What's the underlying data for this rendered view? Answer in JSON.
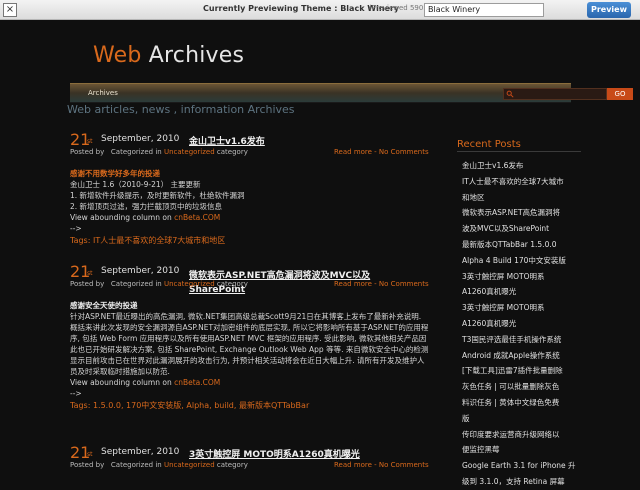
{
  "preview_bar": {
    "close_label": "×",
    "title": "Currently Previewing Theme : Black Winery",
    "subtitle": "(Previewed 590 tim",
    "theme_select": "Black Winery",
    "preview_button": "Preview"
  },
  "header": {
    "title_part1": "Web",
    "title_part2": " Archives",
    "tagline": "Web articles, news , information Archives",
    "nav_item": "Archives",
    "search_placeholder": "",
    "go_button": "GO"
  },
  "posts": [
    {
      "day": "21",
      "suffix": "st",
      "date": "September, 2010",
      "title": "金山卫士v1.6发布",
      "meta_posted": "Posted by",
      "meta_cat_prefix": "Categorized in",
      "meta_cat": "Uncategorized",
      "meta_cat_suffix": "category",
      "more": "Read more - No Comments",
      "lines": [
        "感谢不用数学好多年的投递",
        "金山卫士 1.6（2010-9-21） 主要更新",
        "1. 新增软件升级提示，及时更新软件，杜绝软件漏洞",
        "2. 新增顶页过滤，强力拦截顶页中的垃圾信息",
        "View abounding column on ",
        "cnBeta.COM",
        "-->"
      ],
      "tags_label": "Tags:",
      "tags": "IT人士最不喜欢的全球7大城市和地区"
    },
    {
      "day": "21",
      "suffix": "st",
      "date": "September, 2010",
      "title": "微软表示ASP.NET高危漏洞将波及MVC以及SharePoint",
      "meta_posted": "Posted by",
      "meta_cat_prefix": "Categorized in",
      "meta_cat": "Uncategorized",
      "meta_cat_suffix": "category",
      "more": "Read more - No Comments",
      "lines": [
        "感谢安全天使的投递",
        "针对ASP.NET最近曝出的高危漏洞, 微软.NET集团高级总裁Scott9月21日在其博客上发布了最新补充说明. 概括来讲此次发现的安全漏洞源自ASP.NET对加密组件的底层实现, 所以它将影响所有基于ASP.NET的应用程序, 包括 Web Form 应用程序以及所有使用ASP.NET MVC 框架的应用程序. 受此影响, 微软其他相关产品因此也已开始研发解决方案, 包括 SharePoint, Exchange Outlook Web App 等等. 来自微软安全中心的检测显示目前攻击已在世界对此漏洞展开的攻击行为, 并预计相关活动将会在近日大幅上升. 请所有开发及维护人员及时采取临时措施加以防范.",
        "View abounding column on ",
        "cnBeta.COM",
        "-->"
      ],
      "tags_label": "Tags:",
      "tags": "1.5.0.0, 170中文安装版, Alpha, build, 最新版本QTTabBar"
    },
    {
      "day": "21",
      "suffix": "st",
      "date": "September, 2010",
      "title": "3英寸触控屏 MOTO明系A1260真机曝光",
      "meta_posted": "Posted by",
      "meta_cat_prefix": "Categorized in",
      "meta_cat": "Uncategorized",
      "meta_cat_suffix": "category",
      "more": "Read more - No Comments"
    }
  ],
  "sidebar": {
    "title": "Recent Posts",
    "items": [
      "金山卫士v1.6发布",
      "IT人士最不喜欢的全球7大城市",
      "和地区",
      "微软表示ASP.NET高危漏洞将",
      "波及MVC以及SharePoint",
      "最新版本QTTabBar 1.5.0.0",
      "Alpha 4 Build 170中文安装版",
      "3英寸触控屏 MOTO明系",
      "A1260真机曝光",
      "3英寸触控屏 MOTO明系",
      "A1260真机曝光",
      "T3国民评选最佳手机操作系统",
      "Android 成就Apple操作系统",
      "[下载工具]迅雷7插件批量删除",
      "灰色任务 | 可以批量删除灰色",
      "料识任务 | 黄体中文绿色免费",
      "版",
      "传印度要求运营商升级网络以",
      "便监控黑莓",
      "Google Earth 3.1 for iPhone 升",
      "级到 3.1.0，支持 Retina 屏幕"
    ]
  },
  "colors": {
    "accent": "#d9691c",
    "background": "#0f0f0f",
    "text": "#d8d8d8"
  }
}
